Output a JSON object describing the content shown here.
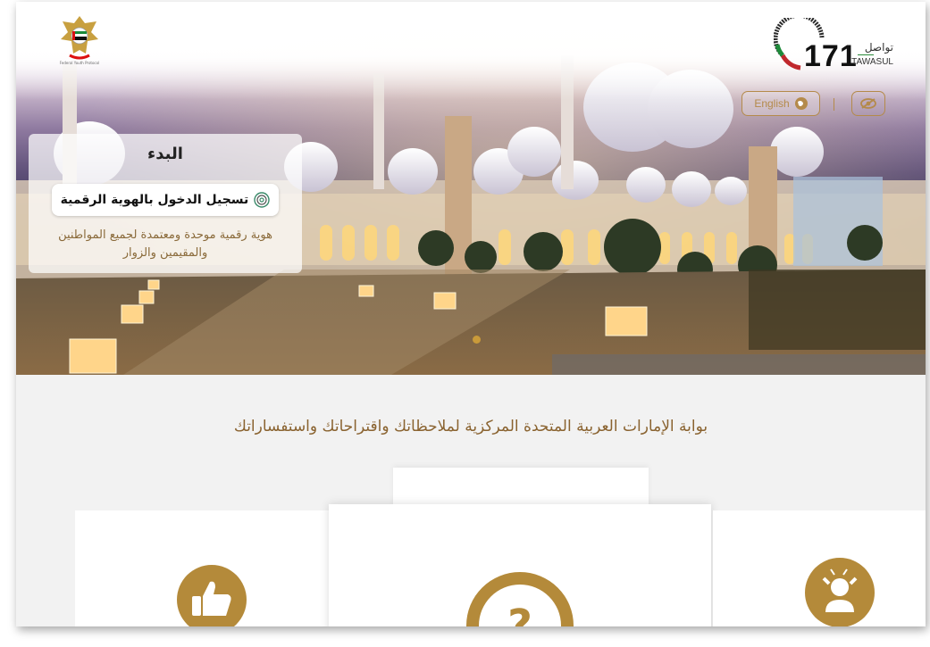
{
  "header": {
    "emblem_caption": "Federal Youth Protocol",
    "logo": {
      "number": "171",
      "arabic": "تواصل",
      "english": "TAWASUL"
    },
    "language_button": "English",
    "icons": [
      "globe-icon",
      "eye-slash-icon"
    ],
    "accent_color": "#b48a4a"
  },
  "start_card": {
    "title": "البدء",
    "uaepass_button": "تسجيل الدخول بالهوية الرقمية",
    "description": "هوية رقمية موحدة ومعتمدة لجميع المواطنين والمقيمين والزوار"
  },
  "main": {
    "headline": "بوابة الإمارات العربية المتحدة المركزية لملاحظاتك واقتراحاتك واستفساراتك",
    "cards": [
      {
        "icon": "thumbs-up-icon"
      },
      {
        "icon": "question-mark-icon"
      },
      {
        "icon": "frustrated-person-icon"
      }
    ]
  }
}
